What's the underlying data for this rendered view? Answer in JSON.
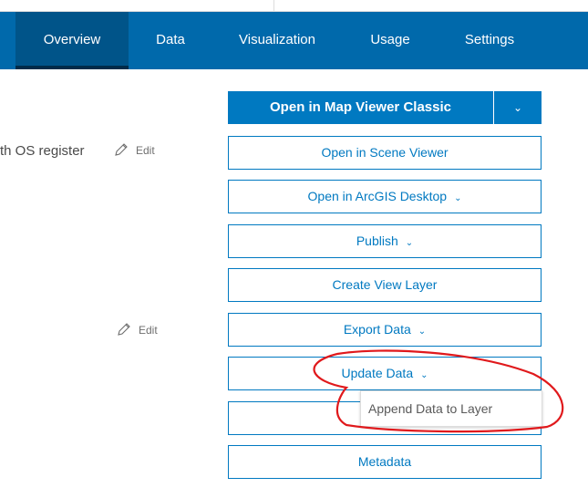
{
  "nav": {
    "tabs": [
      {
        "label": "Overview",
        "active": true
      },
      {
        "label": "Data"
      },
      {
        "label": "Visualization"
      },
      {
        "label": "Usage"
      },
      {
        "label": "Settings"
      }
    ]
  },
  "content": {
    "description_fragment": "th OS register",
    "edit_label": "Edit"
  },
  "actions": {
    "primary": "Open in Map Viewer Classic",
    "scene": "Open in Scene Viewer",
    "desktop": "Open in ArcGIS Desktop",
    "publish": "Publish",
    "view_layer": "Create View Layer",
    "export": "Export Data",
    "update": "Update Data",
    "metadata": "Metadata"
  },
  "dropdown": {
    "items": [
      "Append Data to Layer"
    ]
  },
  "colors": {
    "nav": "#0069ab",
    "accent": "#0079c1",
    "annotation": "#e0191c"
  }
}
